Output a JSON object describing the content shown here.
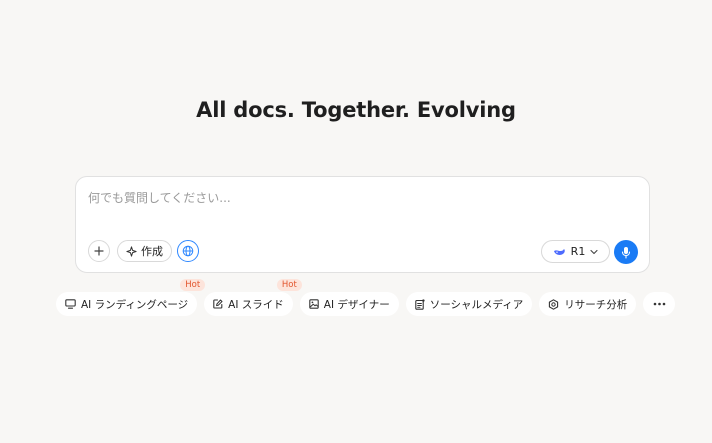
{
  "hero": {
    "title": "All docs. Together. Evolving"
  },
  "composer": {
    "placeholder": "何でも質問してください...",
    "value": "",
    "create_label": "作成",
    "model_label": "R1"
  },
  "tools": [
    {
      "label": "AI ランディングページ",
      "badge": "Hot",
      "icon": "monitor-icon"
    },
    {
      "label": "AI スライド",
      "badge": "Hot",
      "icon": "edit-icon"
    },
    {
      "label": "AI デザイナー",
      "badge": "",
      "icon": "image-icon"
    },
    {
      "label": "ソーシャルメディア",
      "badge": "",
      "icon": "social-post-icon"
    },
    {
      "label": "リサーチ分析",
      "badge": "",
      "icon": "research-icon"
    }
  ],
  "colors": {
    "background": "#f8f7f5",
    "accent": "#1a7bf5",
    "hot_badge_bg": "#fde4db",
    "hot_badge_text": "#e2552d"
  }
}
